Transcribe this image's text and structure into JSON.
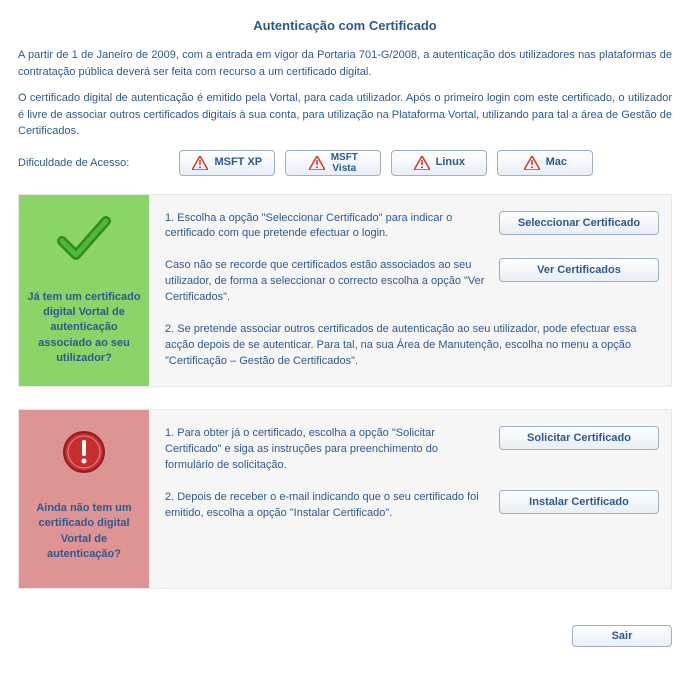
{
  "title": "Autenticação com Certificado",
  "intro": {
    "p1": "A partir de 1 de Janeiro de 2009, com a entrada em vigor da Portaria 701-G/2008, a autenticação dos utilizadores nas plataformas de contratação pública deverá ser feita com recurso a um certificado digital.",
    "p2": "O certificado digital de autenticação é emitido pela Vortal, para cada utilizador. Após o primeiro login com este certificado, o utilizador é livre de associar outros certificados digitais à sua conta, para utilização na Plataforma Vortal, utilizando para tal a área de Gestão de Certificados."
  },
  "access": {
    "label": "Dificuldade de Acesso:",
    "buttons": {
      "xp": "MSFT XP",
      "vista_l1": "MSFT",
      "vista_l2": "Vista",
      "linux": "Linux",
      "mac": "Mac"
    }
  },
  "panel_has": {
    "question": "Já tem um certificado digital Vortal de autenticação associado ao seu utilizador?",
    "step1": "1. Escolha a opção \"Seleccionar Certificado\" para indicar o certificado com que pretende efectuar o login.",
    "btn1": "Seleccionar Certificado",
    "hint": "Caso não se recorde que certificados estão associados ao seu utilizador, de forma a seleccionar o correcto escolha a opção \"Ver Certificados\".",
    "btn2": "Ver Certificados",
    "step2": "2. Se pretende associar outros certificados de autenticação ao seu utilizador, pode efectuar essa acção depois de se autenticar. Para tal, na sua Área de Manutenção, escolha no menu a opção \"Certificação – Gestão de Certificados\"."
  },
  "panel_no": {
    "question": "Ainda não tem um certificado digital Vortal de autenticação?",
    "step1": "1. Para obter já o certificado, escolha a opção \"Solicitar Certificado\" e siga as instruções para preenchimento do formulário de solicitação.",
    "btn1": "Solicitar Certificado",
    "step2": "2. Depois de receber o e-mail indicando que o seu certificado foi emitido, escolha a opção \"Instalar Certificado\".",
    "btn2": "Instalar Certificado"
  },
  "footer": {
    "exit": "Sair"
  }
}
